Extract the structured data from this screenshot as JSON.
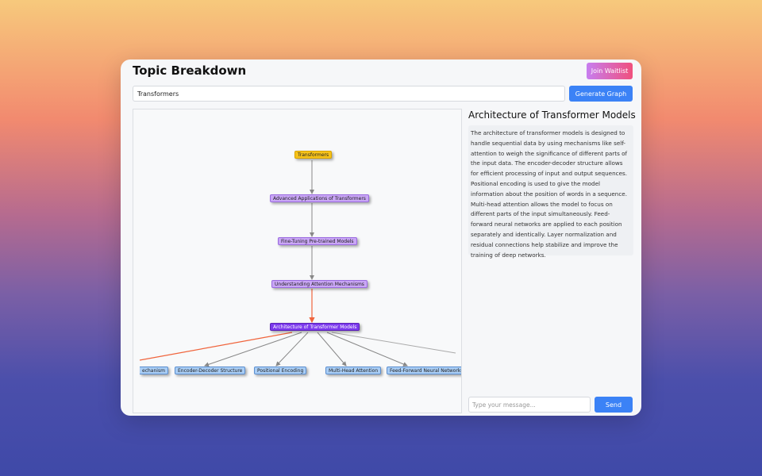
{
  "header": {
    "title": "Topic Breakdown",
    "waitlist_label": "Join Waitlist"
  },
  "topic": {
    "value": "Transformers",
    "generate_label": "Generate Graph"
  },
  "graph": {
    "root": "Transformers",
    "chain": [
      "Advanced Applications of Transformers",
      "Fine-Tuning Pre-trained Models",
      "Understanding Attention Mechanisms"
    ],
    "active": "Architecture of Transformer Models",
    "children": [
      "echanism",
      "Encoder-Decoder Structure",
      "Positional Encoding",
      "Multi-Head Attention",
      "Feed-Forward Neural Networks"
    ],
    "colors": {
      "root": "#f6c21a",
      "chain": "#c9a6f5",
      "active": "#7c3aed",
      "children": "#a9cdf5",
      "highlight_edge": "#f0643c",
      "edge": "#888888"
    }
  },
  "detail": {
    "title": "Architecture of Transformer Models",
    "text": "The architecture of transformer models is designed to handle sequential data by using mechanisms like self-attention to weigh the significance of different parts of the input data. The encoder-decoder structure allows for efficient processing of input and output sequences. Positional encoding is used to give the model information about the position of words in a sequence. Multi-head attention allows the model to focus on different parts of the input simultaneously. Feed-forward neural networks are applied to each position separately and identically. Layer normalization and residual connections help stabilize and improve the training of deep networks."
  },
  "chat": {
    "placeholder": "Type your message...",
    "send_label": "Send"
  }
}
